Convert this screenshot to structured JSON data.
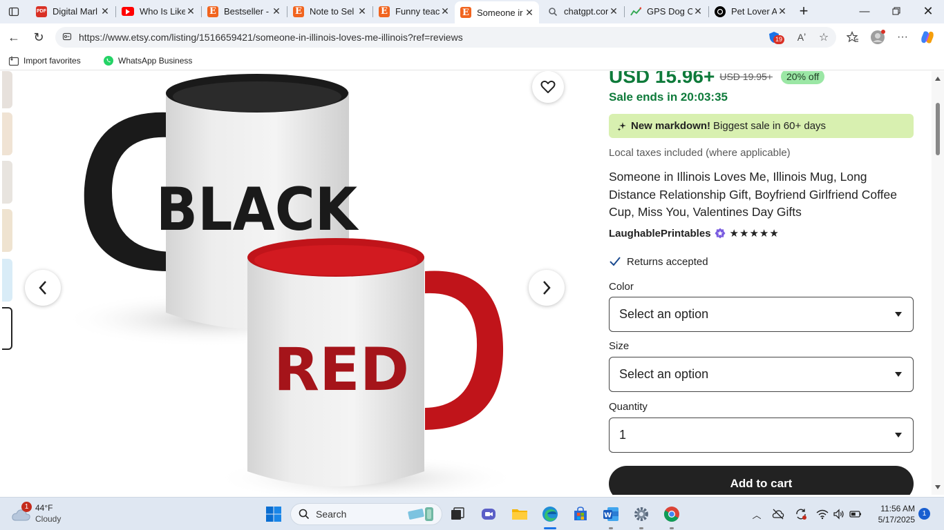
{
  "tabs": [
    {
      "title": "Digital Marl",
      "favicon": "pdf-icon",
      "color": "#d93025"
    },
    {
      "title": "Who Is Like",
      "favicon": "youtube-icon",
      "color": "#ff0000"
    },
    {
      "title": "Bestseller -",
      "favicon": "etsy-icon",
      "color": "#f1641e"
    },
    {
      "title": "Note to Sel",
      "favicon": "etsy-icon",
      "color": "#f1641e"
    },
    {
      "title": "Funny teacl",
      "favicon": "etsy-icon",
      "color": "#f1641e"
    },
    {
      "title": "Someone ir",
      "favicon": "etsy-icon",
      "color": "#f1641e",
      "active": true
    },
    {
      "title": "chatgpt.cor",
      "favicon": "search-icon",
      "color": "#5f6368"
    },
    {
      "title": "GPS Dog C",
      "favicon": "chart-icon",
      "color": "#34a853"
    },
    {
      "title": "Pet Lover A",
      "favicon": "chatgpt-icon",
      "color": "#000000"
    }
  ],
  "address": {
    "url": "https://www.etsy.com/listing/1516659421/someone-in-illinois-loves-me-illinois?ref=reviews",
    "extension_badge": "19"
  },
  "favorites_bar": {
    "import_label": "Import favorites",
    "whatsapp_label": "WhatsApp Business"
  },
  "product": {
    "price": "USD 15.96+",
    "original_price": "USD 19.95+",
    "discount": "20% off",
    "sale_ends": "Sale ends in 20:03:35",
    "markdown_bold": "New markdown!",
    "markdown_text": "Biggest sale in 60+ days",
    "taxes": "Local taxes included (where applicable)",
    "title": "Someone in Illinois Loves Me, Illinois Mug, Long Distance Relationship Gift, Boyfriend Girlfriend Coffee Cup, Miss You, Valentines Day Gifts",
    "shop_name": "LaughablePrintables",
    "stars": "★★★★★",
    "returns": "Returns accepted",
    "color_label": "Color",
    "color_value": "Select an option",
    "size_label": "Size",
    "size_value": "Select an option",
    "quantity_label": "Quantity",
    "quantity_value": "1",
    "add_to_cart": "Add to cart"
  },
  "image": {
    "mug1_text": "BLACK",
    "mug2_text": "RED",
    "mug1_color": "#1a1a1a",
    "mug2_color": "#c0141a",
    "mug2_text_color": "#a5141a"
  },
  "colors": {
    "price_green": "#0e7a3a",
    "discount_bg": "#9be7a5",
    "markdown_bg": "#d8f0b0",
    "cart_bg": "#222222"
  },
  "taskbar": {
    "weather_temp": "44°F",
    "weather_cond": "Cloudy",
    "weather_notif": "1",
    "search_placeholder": "Search",
    "time": "11:56 AM",
    "date": "5/17/2025",
    "notif_count": "1"
  }
}
